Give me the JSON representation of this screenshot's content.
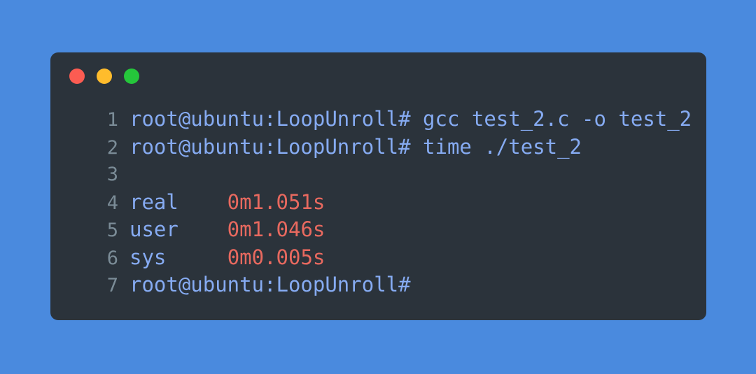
{
  "window": {
    "background_color": "#4a8ade",
    "panel_color": "#2b333b",
    "controls": [
      {
        "name": "close",
        "label": "Close",
        "color": "#fc5c52"
      },
      {
        "name": "minimize",
        "label": "Minimize",
        "color": "#ffbc2c"
      },
      {
        "name": "maximize",
        "label": "Maximize",
        "color": "#25c63b"
      }
    ]
  },
  "colors": {
    "prompt": "#86abf2",
    "command": "#86abf2",
    "value": "#e8695f",
    "line_number": "#7b8c97"
  },
  "terminal": {
    "prompt": "root@ubuntu:LoopUnroll#",
    "lines": [
      {
        "number": "1",
        "prompt": "root@ubuntu:LoopUnroll#",
        "command": " gcc test_2.c -o test_2",
        "label": "",
        "value": ""
      },
      {
        "number": "2",
        "prompt": "root@ubuntu:LoopUnroll#",
        "command": " time ./test_2",
        "label": "",
        "value": ""
      },
      {
        "number": "3",
        "prompt": "",
        "command": "",
        "label": "",
        "value": ""
      },
      {
        "number": "4",
        "prompt": "",
        "command": "",
        "label": "real",
        "value": "    0m1.051s"
      },
      {
        "number": "5",
        "prompt": "",
        "command": "",
        "label": "user",
        "value": "    0m1.046s"
      },
      {
        "number": "6",
        "prompt": "",
        "command": "",
        "label": "sys",
        "value": "     0m0.005s"
      },
      {
        "number": "7",
        "prompt": "root@ubuntu:LoopUnroll#",
        "command": "",
        "label": "",
        "value": ""
      }
    ]
  }
}
